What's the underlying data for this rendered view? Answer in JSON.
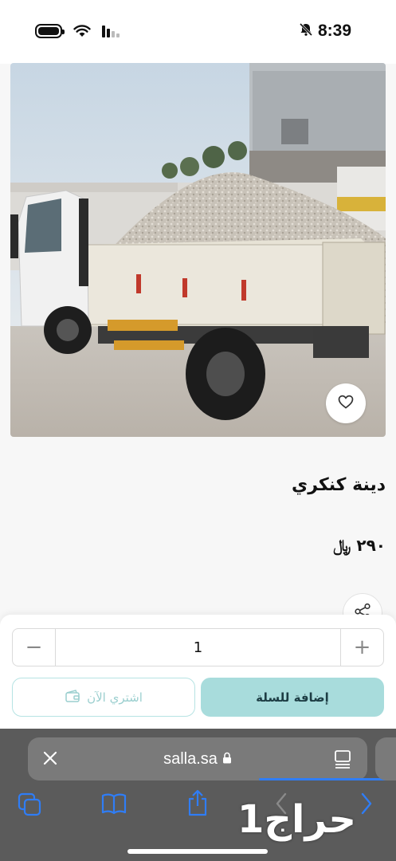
{
  "status_bar": {
    "time": "8:39"
  },
  "product": {
    "title": "دينة كنكري",
    "price": "٢٩٠ ﷼",
    "image_alt": "dump truck loaded with gravel"
  },
  "icons": {
    "wishlist": "heart-icon",
    "share": "share-icon",
    "wallet": "wallet-icon",
    "close": "close-icon",
    "lock": "lock-icon",
    "reader": "reader-icon",
    "tabs": "tabs-icon",
    "bookmarks": "bookmarks-icon",
    "share_sheet": "share-sheet-icon",
    "back": "chevron-left-icon",
    "forward": "chevron-right-icon"
  },
  "purchase": {
    "minus": "−",
    "plus": "+",
    "quantity": "1",
    "buy_now_label": "اشتري الآن",
    "add_to_cart_label": "إضافة للسلة"
  },
  "browser": {
    "url": "salla.sa"
  },
  "watermark": "حراج1",
  "colors": {
    "accent": "#a8dcdc",
    "accent_text": "#1d3d44",
    "browser_bg": "#5b5b5b",
    "link_blue": "#2f7df6"
  }
}
